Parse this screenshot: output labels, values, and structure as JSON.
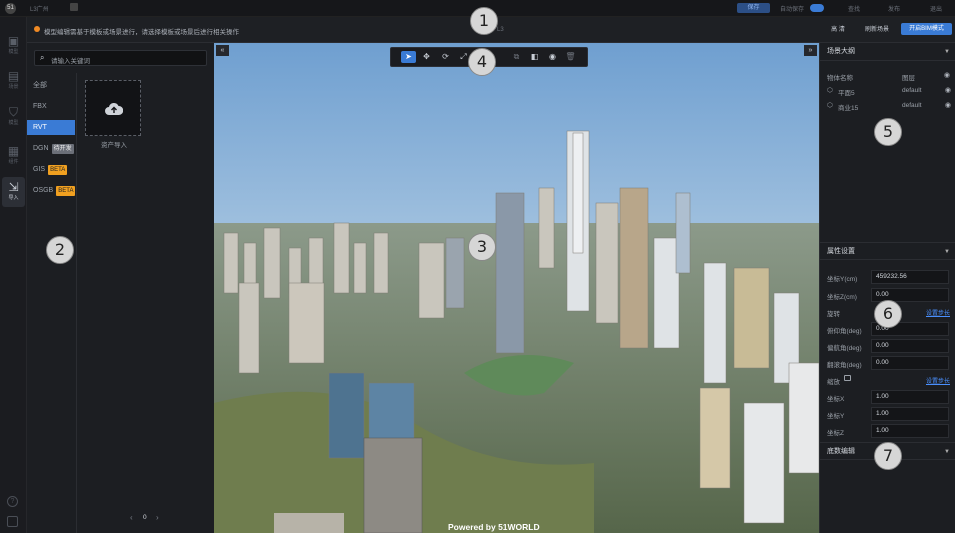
{
  "topbar": {
    "title": "L3广州",
    "save_label": "保存",
    "auto_save_label": "自动保存",
    "search_label": "查找",
    "publish_label": "发布",
    "exit_label": "退出"
  },
  "leftnav": {
    "items": [
      {
        "label": "模型",
        "icon": "cube-icon"
      },
      {
        "label": "场景",
        "icon": "layers-icon"
      },
      {
        "label": "模型",
        "icon": "shield-icon"
      },
      {
        "label": "组件",
        "icon": "grid-icon"
      },
      {
        "label": "导入",
        "icon": "import-icon"
      }
    ]
  },
  "subbar": {
    "notice": "模型编辑需基于模板或场景进行，请选择模板或场景后进行相关操作",
    "scene_name": "L3",
    "quality_label": "高 清",
    "refresh_label": "刷新场景",
    "bim_label": "开启BIM模式"
  },
  "assets": {
    "search_placeholder": "请输入关键词",
    "categories": [
      {
        "label": "全部"
      },
      {
        "label": "FBX"
      },
      {
        "label": "RVT"
      },
      {
        "label": "DGN",
        "badge": "待开发"
      },
      {
        "label": "GIS",
        "badge": "BETA"
      },
      {
        "label": "OSGB",
        "badge": "BETA"
      }
    ],
    "tile_label": "资产导入",
    "page": "0"
  },
  "viewport": {
    "watermark": "Powered by 51WORLD"
  },
  "scene_outline": {
    "title": "场景大纲",
    "columns": [
      "物体名称",
      "图层"
    ],
    "items": [
      {
        "name": "平面5",
        "layer": "default"
      },
      {
        "name": "商业15",
        "layer": "default"
      }
    ]
  },
  "properties": {
    "title": "属性设置",
    "fields": [
      {
        "label": "坐标Y(cm)",
        "value": "459232.56"
      },
      {
        "label": "坐标Z(cm)",
        "value": "0.00"
      },
      {
        "label": "旋转",
        "link": "设置步长"
      },
      {
        "label": "俯仰角(deg)",
        "value": "0.00"
      },
      {
        "label": "偏航角(deg)",
        "value": "0.00"
      },
      {
        "label": "翻滚角(deg)",
        "value": "0.00"
      },
      {
        "label": "缩放",
        "link": "设置步长"
      },
      {
        "label": "坐标X",
        "value": "1.00"
      },
      {
        "label": "坐标Y",
        "value": "1.00"
      },
      {
        "label": "坐标Z",
        "value": "1.00"
      }
    ]
  },
  "material_editor": {
    "title": "底数编辑"
  },
  "markers": [
    "1",
    "2",
    "3",
    "4",
    "5",
    "6",
    "7"
  ],
  "colors": {
    "accent": "#3a7bd5",
    "beta": "#f0a020",
    "notice": "#f08a24"
  }
}
